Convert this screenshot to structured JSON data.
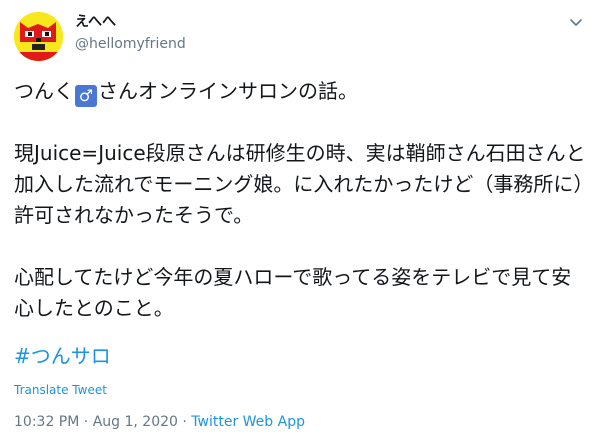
{
  "user": {
    "display_name": "えへへ",
    "handle": "@hellomyfriend",
    "avatar_icon": "cartoon-cat-face-icon",
    "avatar_bg": "#f8e71c"
  },
  "tweet": {
    "line1_before": "つんく",
    "emoji_male": "♂",
    "line1_after": "さんオンラインサロンの話。",
    "para2": "現Juice=Juice段原さんは研修生の時、実は鞘師さん石田さんと加入した流れでモーニング娘。に入れたかったけど（事務所に）許可されなかったそうで。",
    "para3": "心配してたけど今年の夏ハローで歌ってる姿をテレビで見て安心したとのこと。",
    "hashtag": "#つんサロ",
    "translate": "Translate Tweet",
    "time": "10:32 PM",
    "sep1": " · ",
    "date": "Aug 1, 2020",
    "sep2": " · ",
    "source": "Twitter Web App"
  },
  "colors": {
    "link": "#1b95e0",
    "muted": "#657786",
    "text": "#14171a"
  }
}
